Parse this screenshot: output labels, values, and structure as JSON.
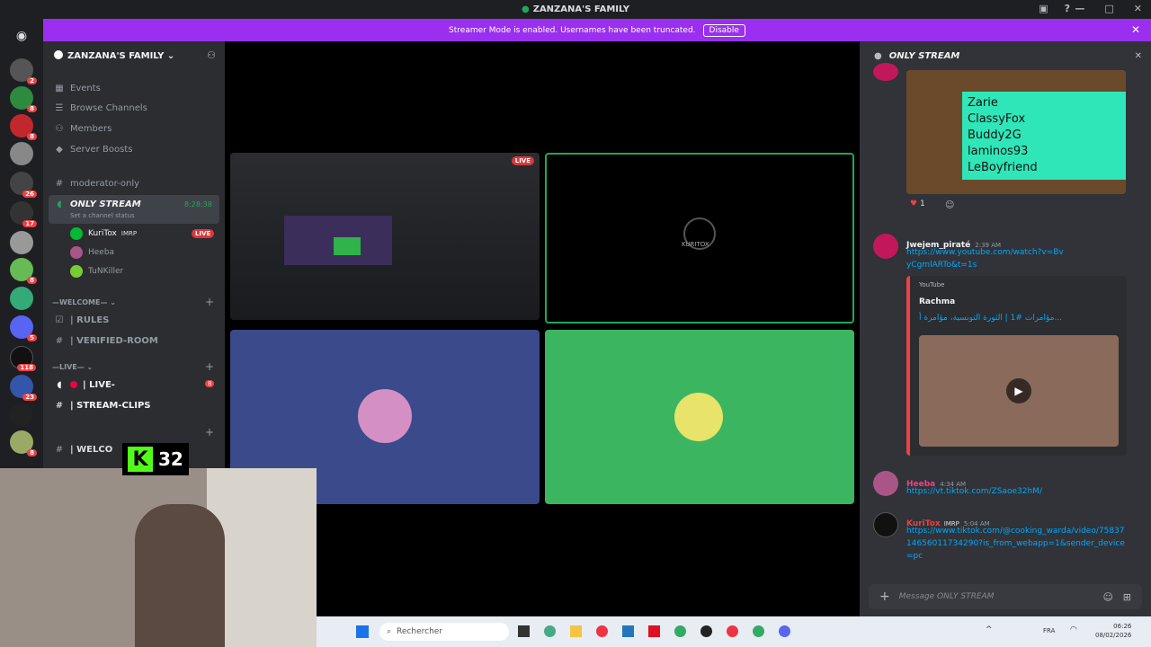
{
  "window": {
    "title": "ZANZANA'S FAMILY"
  },
  "banner": {
    "text": "Streamer Mode is enabled. Usernames have been truncated.",
    "disable": "Disable"
  },
  "rail": {
    "badges": [
      "2",
      "8",
      "8",
      "26",
      "17",
      "8",
      "5",
      "118",
      "23",
      "8"
    ]
  },
  "sidebar": {
    "server_name": "ZANZANA'S FAMILY",
    "items": [
      {
        "label": "Events",
        "icon": "calendar-icon"
      },
      {
        "label": "Browse Channels",
        "icon": "browse-icon"
      },
      {
        "label": "Members",
        "icon": "members-icon"
      },
      {
        "label": "Server Boosts",
        "icon": "boost-icon"
      }
    ],
    "moderator": "moderator-only",
    "voice": {
      "name": "ONLY STREAM",
      "timer": "8:28:38",
      "status": "Set a channel status",
      "users": [
        {
          "name": "KuriTox",
          "tag": "IMRP",
          "live": "LIVE"
        },
        {
          "name": "Heeba"
        },
        {
          "name": "TuNKiller"
        }
      ]
    },
    "cat_welcome": "—WELCOME—",
    "welcome_channels": [
      "| RULES",
      "| VERIFIED-ROOM"
    ],
    "cat_live": "—LIVE—",
    "live_channels": [
      {
        "label": "| LIVE-",
        "badge": "8"
      },
      {
        "label": "| STREAM-CLIPS"
      }
    ],
    "truncated_channel": "| WELCO"
  },
  "stage": {
    "tile1_badge": "LIVE",
    "tile2_label": "KURITOX"
  },
  "kick": {
    "count": "32"
  },
  "chat": {
    "title": "ONLY STREAM",
    "overlay_names": [
      "Zarie",
      "ClassyFox",
      "Buddy2G",
      "laminos93",
      "LeBoyfriend"
    ],
    "reaction_count": "1",
    "messages": [
      {
        "user": "Jwejem_piraté",
        "time": "2:39 AM",
        "link": "https://www.youtube.com/watch?v=BvyCgmlARTo&t=1s"
      },
      {
        "user": "Heeba",
        "time": "4:34 AM",
        "link": "https://vt.tiktok.com/ZSaoe32hM/"
      },
      {
        "user": "KuriTox",
        "tag": "IMRP",
        "time": "5:04 AM",
        "link": "https://www.tiktok.com/@cooking_warda/video/7583714656011734290?is_from_webapp=1&sender_device=pc"
      }
    ],
    "embed": {
      "provider": "YouTube",
      "author": "Rachma",
      "title": "مؤامرات #1 | الثورة التونسية، مؤامرة أ..."
    },
    "placeholder": "Message ONLY STREAM"
  },
  "taskbar": {
    "search": "Rechercher",
    "lang": "FRA",
    "time": "06:26",
    "date": "08/02/2026"
  }
}
